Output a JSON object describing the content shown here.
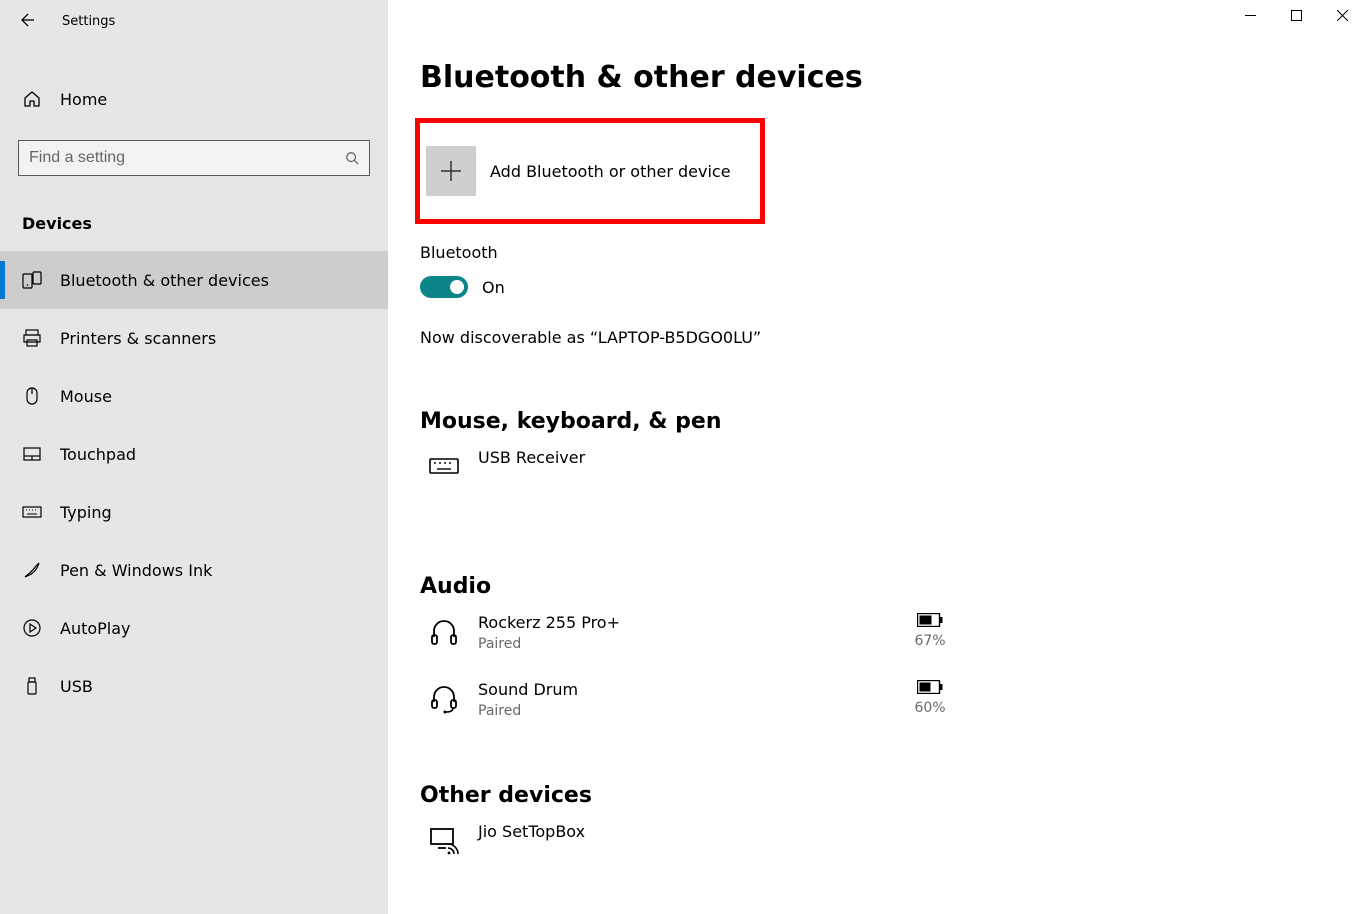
{
  "app_title": "Settings",
  "home_label": "Home",
  "search_placeholder": "Find a setting",
  "category": "Devices",
  "nav": [
    {
      "label": "Bluetooth & other devices",
      "icon": "bluetooth-devices-icon",
      "selected": true
    },
    {
      "label": "Printers & scanners",
      "icon": "printer-icon"
    },
    {
      "label": "Mouse",
      "icon": "mouse-icon"
    },
    {
      "label": "Touchpad",
      "icon": "touchpad-icon"
    },
    {
      "label": "Typing",
      "icon": "keyboard-icon"
    },
    {
      "label": "Pen & Windows Ink",
      "icon": "pen-icon"
    },
    {
      "label": "AutoPlay",
      "icon": "autoplay-icon"
    },
    {
      "label": "USB",
      "icon": "usb-icon"
    }
  ],
  "page_title": "Bluetooth & other devices",
  "add_button_label": "Add Bluetooth or other device",
  "bluetooth": {
    "label": "Bluetooth",
    "state_text": "On",
    "discoverable_text": "Now discoverable as “LAPTOP-B5DGO0LU”"
  },
  "sections": {
    "mouse_kb_pen": {
      "heading": "Mouse, keyboard, & pen",
      "items": [
        {
          "name": "USB Receiver",
          "status": "",
          "icon": "keyboard-device-icon"
        }
      ]
    },
    "audio": {
      "heading": "Audio",
      "items": [
        {
          "name": "Rockerz 255 Pro+",
          "status": "Paired",
          "icon": "headphones-icon",
          "battery": "67%"
        },
        {
          "name": "Sound Drum",
          "status": "Paired",
          "icon": "headset-icon",
          "battery": "60%"
        }
      ]
    },
    "other": {
      "heading": "Other devices",
      "items": [
        {
          "name": "Jio SetTopBox",
          "status": "",
          "icon": "screen-cast-icon"
        }
      ]
    }
  }
}
